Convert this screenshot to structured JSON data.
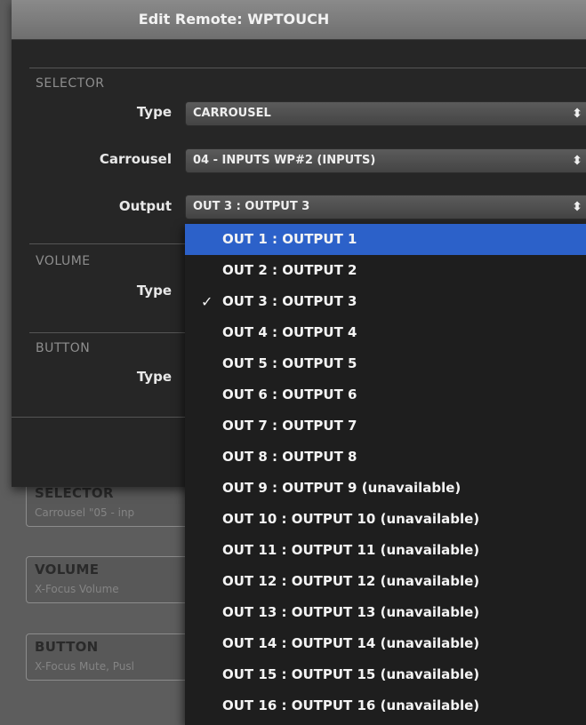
{
  "window": {
    "title": "Edit Remote: WPTOUCH"
  },
  "selector": {
    "section": "SELECTOR",
    "type_label": "Type",
    "type_value": "CARROUSEL",
    "carrousel_label": "Carrousel",
    "carrousel_value": "04 - INPUTS WP#2 (INPUTS)",
    "output_label": "Output",
    "output_value": "OUT 3 : OUTPUT 3"
  },
  "volume": {
    "section": "VOLUME",
    "type_label": "Type"
  },
  "button": {
    "section": "BUTTON",
    "type_label": "Type"
  },
  "background": {
    "selector_title": "SELECTOR",
    "selector_sub": "Carrousel \"05 - inp",
    "volume_title": "VOLUME",
    "volume_sub": "X-Focus Volume",
    "button_title": "BUTTON",
    "button_sub": "X-Focus Mute, Pusl"
  },
  "output_options": [
    "OUT 1 : OUTPUT 1",
    "OUT 2 : OUTPUT 2",
    "OUT 3 : OUTPUT 3",
    "OUT 4 : OUTPUT 4",
    "OUT 5 : OUTPUT 5",
    "OUT 6 : OUTPUT 6",
    "OUT 7 : OUTPUT 7",
    "OUT 8 : OUTPUT 8",
    "OUT 9 : OUTPUT 9 (unavailable)",
    "OUT 10 : OUTPUT 10 (unavailable)",
    "OUT 11 : OUTPUT 11 (unavailable)",
    "OUT 12 : OUTPUT 12 (unavailable)",
    "OUT 13 : OUTPUT 13 (unavailable)",
    "OUT 14 : OUTPUT 14 (unavailable)",
    "OUT 15 : OUTPUT 15 (unavailable)",
    "OUT 16 : OUTPUT 16 (unavailable)"
  ],
  "highlighted_index": 0,
  "checked_index": 2,
  "check_glyph": "✓",
  "select_arrows_glyph": "⬍",
  "colors": {
    "highlight": "#2c61c9",
    "sheet": "#262626",
    "titlebar": "#7c7c7c"
  }
}
